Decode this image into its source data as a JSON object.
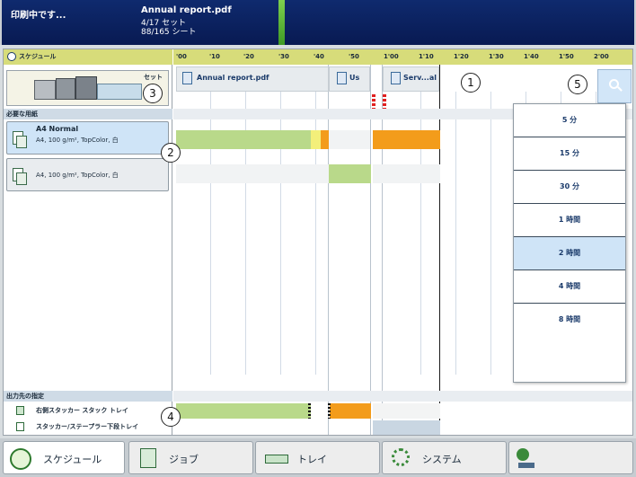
{
  "status": {
    "printing_label": "印刷中です...",
    "job_name": "Annual report.pdf",
    "sets": "4/17 セット",
    "sheets": "88/165 シート"
  },
  "schedule": {
    "header_label": "スケジュール",
    "set_label": "セット",
    "required_paper_label": "必要な用紙",
    "output_label": "出力先の指定",
    "papers": [
      {
        "name": "A4 Normal",
        "desc": "A4, 100 g/m², TopColor, 白"
      },
      {
        "name": "",
        "desc": "A4, 100 g/m², TopColor, 白"
      }
    ],
    "outputs": [
      {
        "label": "右側スタッカー スタック トレイ"
      },
      {
        "label": "スタッカー/ステープラー下段トレイ"
      }
    ],
    "timeline_ticks": [
      "'00",
      "'10",
      "'20",
      "'30",
      "'40",
      "'50",
      "1'00",
      "1'10",
      "1'20",
      "1'30",
      "1'40",
      "1'50",
      "2'00"
    ],
    "jobs": [
      {
        "label": "Annual report.pdf"
      },
      {
        "label": "Us"
      },
      {
        "label": "Serv...al"
      }
    ]
  },
  "zoom_menu": {
    "options": [
      "5 分",
      "15 分",
      "30 分",
      "1 時間",
      "2 時間",
      "4 時間",
      "8 時間"
    ],
    "selected": "2 時間"
  },
  "callouts": [
    "1",
    "2",
    "3",
    "4",
    "5"
  ],
  "tabs": [
    {
      "label": "スケジュール",
      "icon": "clock-icon",
      "selected": true
    },
    {
      "label": "ジョブ",
      "icon": "jobs-icon",
      "selected": false
    },
    {
      "label": "トレイ",
      "icon": "tray-icon",
      "selected": false
    },
    {
      "label": "システム",
      "icon": "gears-icon",
      "selected": false
    },
    {
      "label": "",
      "icon": "user-key-icon",
      "selected": false
    }
  ],
  "colors": {
    "header_blue": "#0f2a6e",
    "progress_green": "#7ed04e",
    "header_strip": "#d7dc7a",
    "bar_green": "#b9d98a",
    "bar_yellow": "#f3ef7a",
    "bar_orange": "#f39c1b",
    "selected_blue": "#cfe4f7"
  }
}
